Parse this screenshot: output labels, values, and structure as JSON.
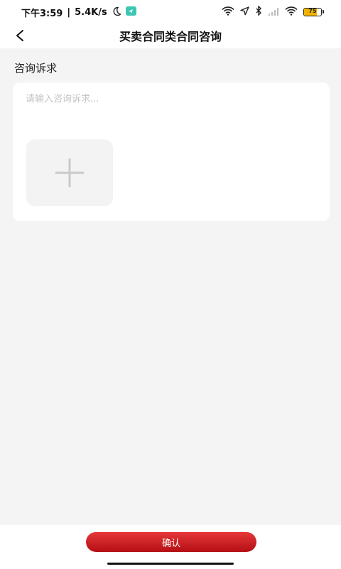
{
  "status_bar": {
    "time": "下午3:59",
    "separator": "|",
    "net_speed": "5.4K/s",
    "battery_level": "75",
    "battery_fraction": 0.75,
    "battery_color": "#f0b400"
  },
  "nav": {
    "title": "买卖合同类合同咨询"
  },
  "form": {
    "section_label": "咨询诉求",
    "textarea_placeholder": "请输入咨询诉求...",
    "textarea_value": ""
  },
  "footer": {
    "confirm_label": "确认",
    "confirm_color": "#c8171c"
  }
}
